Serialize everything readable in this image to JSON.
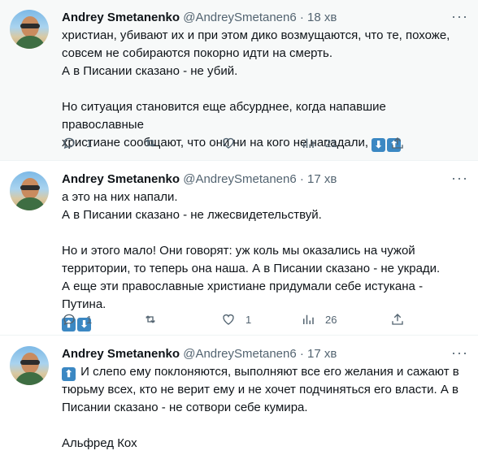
{
  "tweets": [
    {
      "name": "Andrey Smetanenko",
      "handle": "@AndreySmetanen6",
      "dot": "·",
      "time": "18 хв",
      "lines": [
        "христиан, убивают их и при этом дико возмущаются, что те, похоже,",
        "совсем не собираются покорно идти на смерть.",
        "А в Писании сказано - не убий.",
        "",
        "Но ситуация становится еще абсурднее, когда напавшие православные",
        "христиане сообщают, что они ни на кого не нападали,"
      ],
      "replies": "1",
      "retweets": "",
      "likes": "",
      "views": "21"
    },
    {
      "name": "Andrey Smetanenko",
      "handle": "@AndreySmetanen6",
      "dot": "·",
      "time": "17 хв",
      "lines": [
        "а это на них напали.",
        "А в Писании сказано - не лжесвидетельствуй.",
        "",
        "Но и этого мало! Они говорят: уж коль мы оказались на чужой",
        "территории, то теперь она наша. А в Писании сказано - не укради.",
        "А еще эти православные христиане придумали себе истукана - Путина."
      ],
      "replies": "1",
      "retweets": "",
      "likes": "1",
      "views": "26"
    },
    {
      "name": "Andrey Smetanenko",
      "handle": "@AndreySmetanen6",
      "dot": "·",
      "time": "17 хв",
      "lines": [
        "И слепо ему поклоняются, выполняют все его желания и сажают в",
        "тюрьму всех, кто не верит ему и не хочет подчиняться его власти. А в",
        "Писании сказано - не сотвори себе кумира.",
        "",
        "Альфред Кох"
      ]
    }
  ],
  "emoji": {
    "down": "⬇",
    "up": "⬆"
  },
  "more_label": "···",
  "colors": {
    "emoji_bg": "#3b88c3",
    "muted": "#536471"
  }
}
